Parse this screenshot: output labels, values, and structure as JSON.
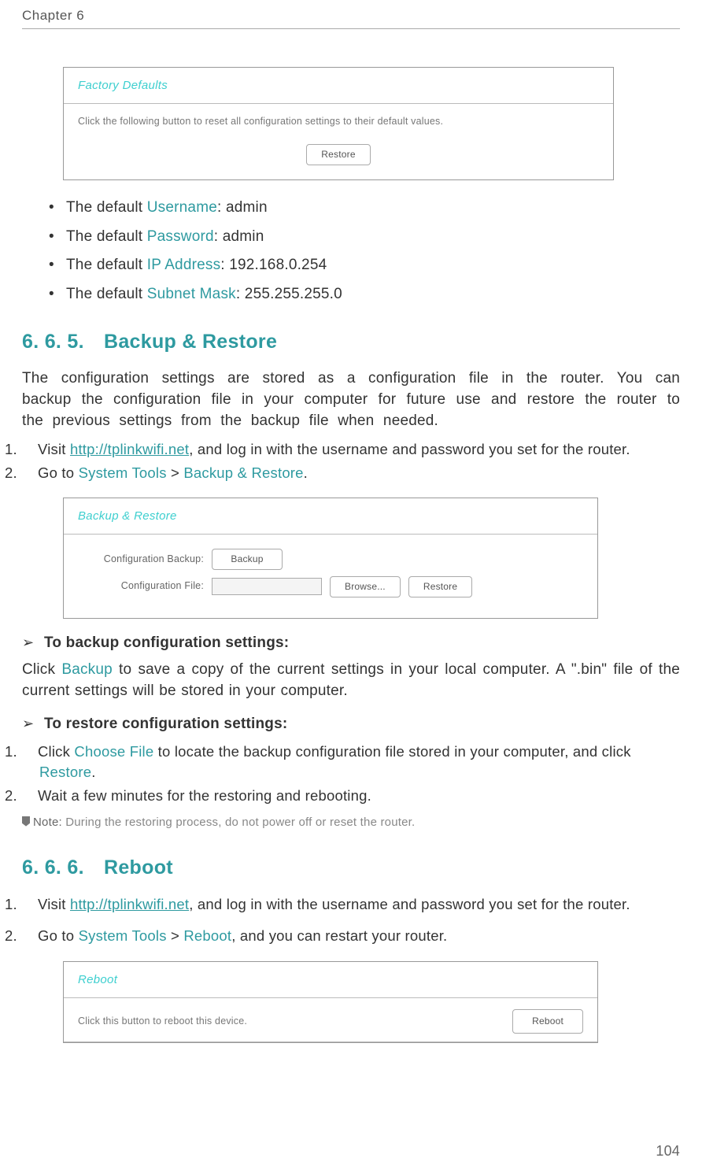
{
  "header": {
    "chapter": "Chapter 6"
  },
  "factoryPanel": {
    "title": "Factory Defaults",
    "instruction": "Click the following button to reset all configuration settings to their default values.",
    "button": "Restore"
  },
  "defaults": {
    "username_prefix": "The default ",
    "username_label": "Username",
    "username_value": ": admin",
    "password_prefix": "The default ",
    "password_label": "Password",
    "password_value": ": admin",
    "ip_prefix": "The default ",
    "ip_label": "IP Address",
    "ip_value": ": 192.168.0.254",
    "subnet_prefix": "The default ",
    "subnet_label": "Subnet Mask",
    "subnet_value": ": 255.255.255.0"
  },
  "section665": {
    "num": "6. 6. 5.",
    "title": "Backup & Restore",
    "para": "The configuration settings are stored as a configuration file in the router. You can backup the configuration file in your computer for future use and restore the router to the previous settings from the backup file when needed.",
    "step1_a": "Visit ",
    "step1_link": "http://tplinkwifi.net",
    "step1_b": ", and log in with the username and password you set for the router.",
    "step2_a": "Go to ",
    "step2_b": "System Tools",
    "step2_c": " > ",
    "step2_d": "Backup & Restore",
    "step2_e": "."
  },
  "backupPanel": {
    "title": "Backup & Restore",
    "row1_label": "Configuration Backup:",
    "row1_btn": "Backup",
    "row2_label": "Configuration File:",
    "row2_browse": "Browse...",
    "row2_restore": "Restore"
  },
  "backupSub": {
    "h1": "To backup configuration settings:",
    "p1_a": "Click ",
    "p1_b": "Backup",
    "p1_c": " to save a copy of the current settings in your local computer. A \".bin\" file of the current settings will be stored in your computer.",
    "h2": "To restore configuration settings:",
    "s1_a": "Click ",
    "s1_b": "Choose File",
    "s1_c": " to locate the backup configuration file stored in your computer, and click ",
    "s1_d": "Restore",
    "s1_e": ".",
    "s2": "Wait a few minutes for the restoring and rebooting.",
    "note_label": "Note:",
    "note_text": " During the restoring process, do not power off or reset the router."
  },
  "section666": {
    "num": "6. 6. 6.",
    "title": "Reboot",
    "step1_a": "Visit ",
    "step1_link": "http://tplinkwifi.net",
    "step1_b": ", and log in with the username and password you set for the router.",
    "step2_a": "Go to ",
    "step2_b": "System Tools",
    "step2_c": " > ",
    "step2_d": "Reboot",
    "step2_e": ", and you can restart your router."
  },
  "rebootPanel": {
    "title": "Reboot",
    "instruction": "Click this button to reboot this device.",
    "button": "Reboot"
  },
  "pageNumber": "104"
}
